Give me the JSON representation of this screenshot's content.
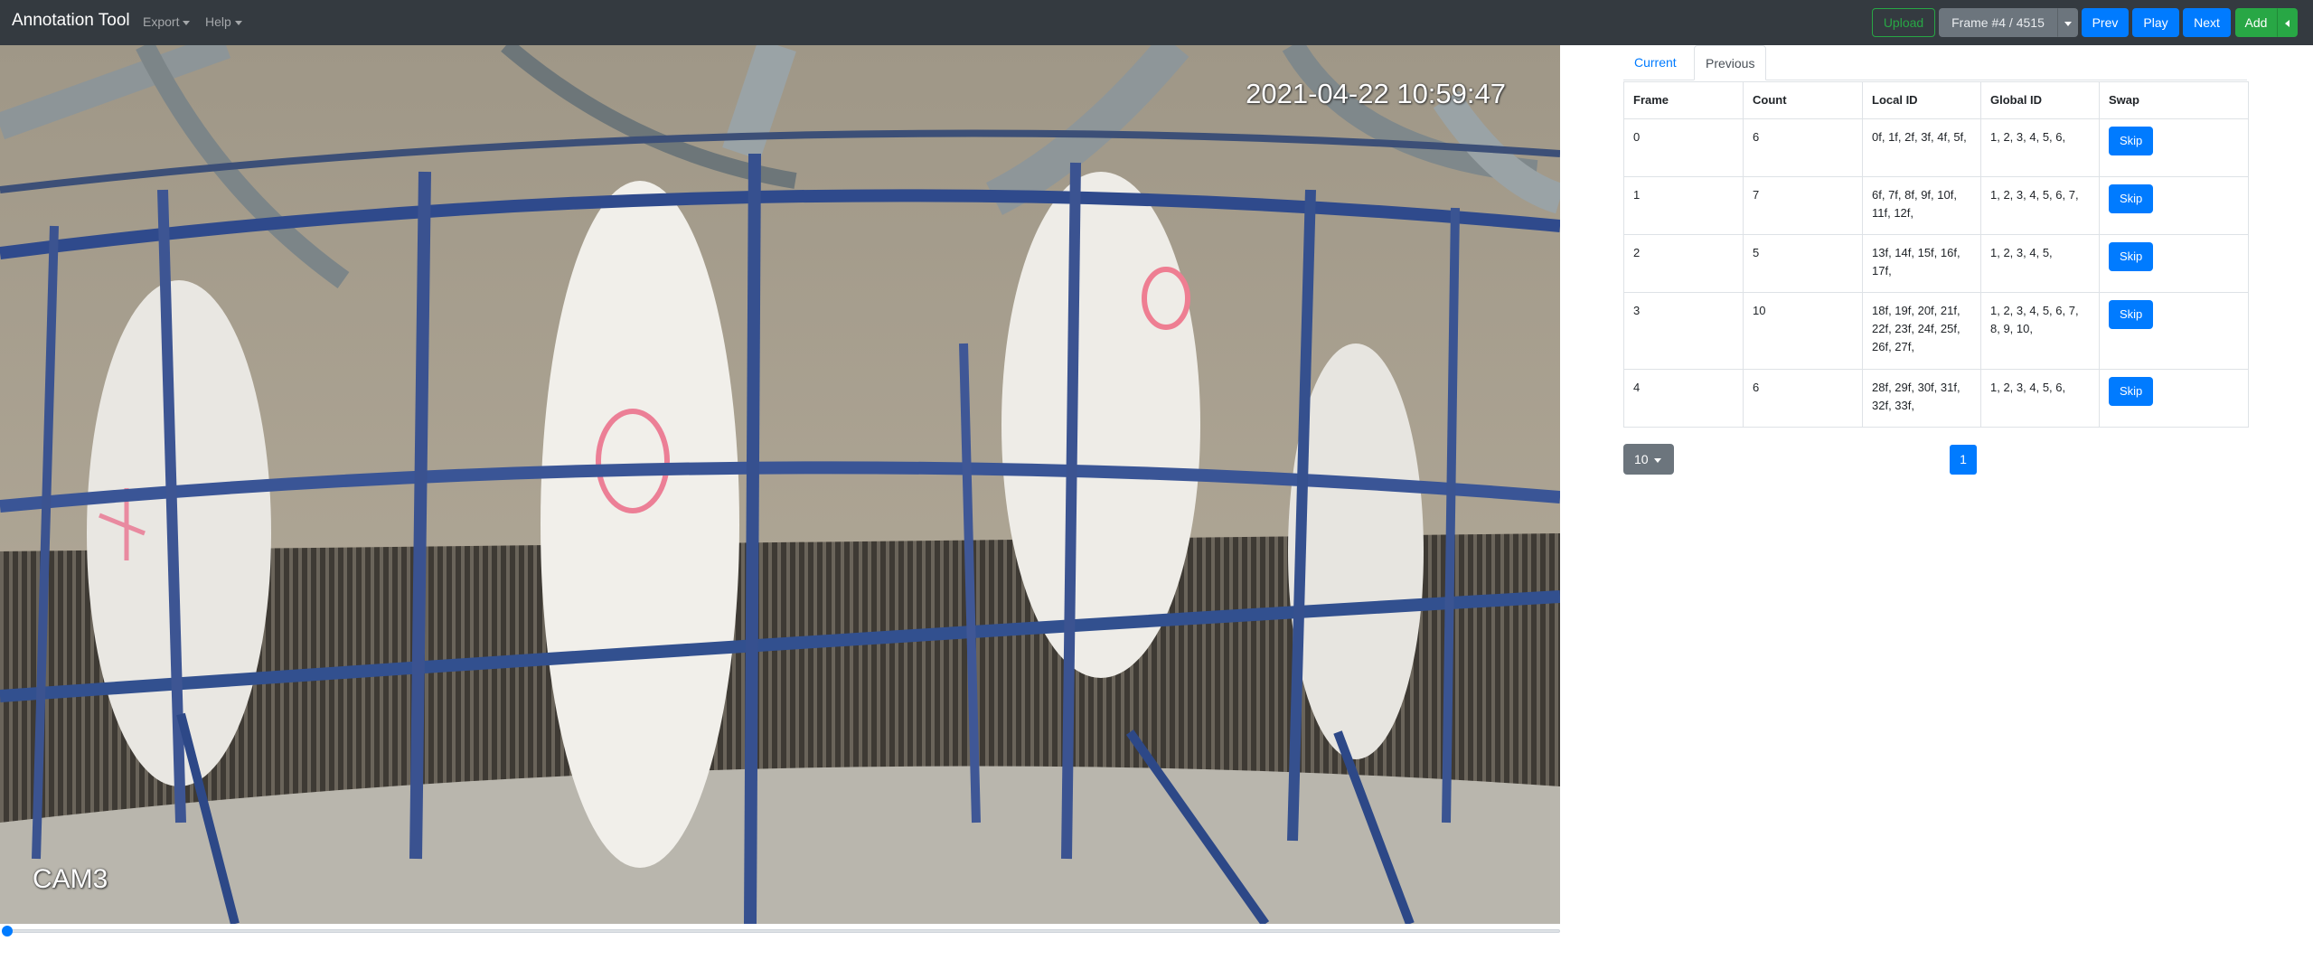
{
  "navbar": {
    "brand": "Annotation Tool",
    "menus": [
      {
        "label": "Export"
      },
      {
        "label": "Help"
      }
    ],
    "upload_label": "Upload",
    "frame_label": "Frame #4 / 4515",
    "prev_label": "Prev",
    "play_label": "Play",
    "next_label": "Next",
    "add_label": "Add"
  },
  "video": {
    "timestamp": "2021-04-22 10:59:47",
    "camera": "CAM3",
    "progress_fraction": 0.001
  },
  "tabs": [
    {
      "label": "Current",
      "active": false
    },
    {
      "label": "Previous",
      "active": true
    }
  ],
  "table": {
    "headers": [
      "Frame",
      "Count",
      "Local ID",
      "Global ID",
      "Swap"
    ],
    "rows": [
      {
        "frame": "0",
        "count": "6",
        "local_id": "0f, 1f, 2f, 3f, 4f, 5f,",
        "global_id": "1, 2, 3, 4, 5, 6,",
        "swap": "Skip"
      },
      {
        "frame": "1",
        "count": "7",
        "local_id": "6f, 7f, 8f, 9f, 10f, 11f, 12f,",
        "global_id": "1, 2, 3, 4, 5, 6, 7,",
        "swap": "Skip"
      },
      {
        "frame": "2",
        "count": "5",
        "local_id": "13f, 14f, 15f, 16f, 17f,",
        "global_id": "1, 2, 3, 4, 5,",
        "swap": "Skip"
      },
      {
        "frame": "3",
        "count": "10",
        "local_id": "18f, 19f, 20f, 21f, 22f, 23f, 24f, 25f, 26f, 27f,",
        "global_id": "1, 2, 3, 4, 5, 6, 7, 8, 9, 10,",
        "swap": "Skip"
      },
      {
        "frame": "4",
        "count": "6",
        "local_id": "28f, 29f, 30f, 31f, 32f, 33f,",
        "global_id": "1, 2, 3, 4, 5, 6,",
        "swap": "Skip"
      }
    ]
  },
  "pagination": {
    "page_size": "10",
    "current_page": "1"
  },
  "colors": {
    "navbar": "#343a40",
    "primary": "#007bff",
    "success": "#28a745",
    "secondary": "#6c757d"
  }
}
